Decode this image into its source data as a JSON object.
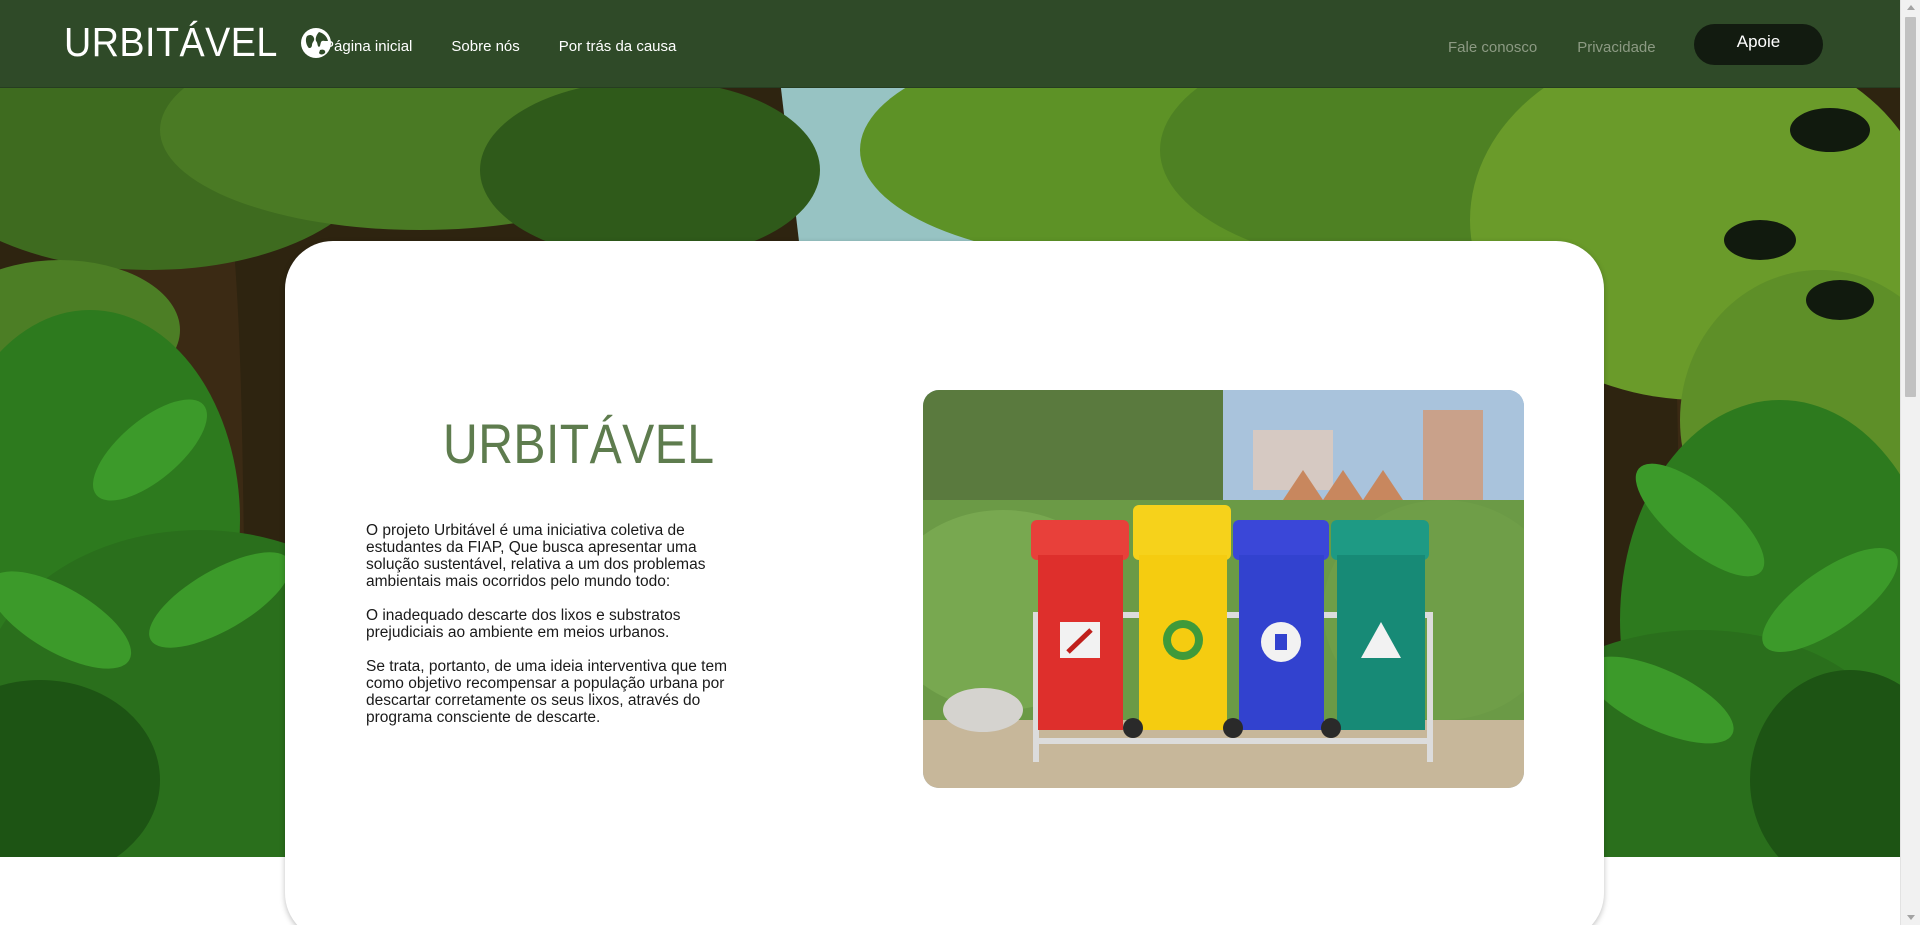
{
  "header": {
    "brand": "URBITÁVEL",
    "nav": [
      "Página inicial",
      "Sobre nós",
      "Por trás da causa"
    ],
    "nav_right": [
      "Fale conosco",
      "Privacidade"
    ],
    "support_label": "Apoie"
  },
  "hero": {
    "title": "URBITÁVEL",
    "paragraphs": [
      "O projeto Urbitável é uma iniciativa coletiva de estudantes da FIAP, Que busca apresentar uma solução sustentável, relativa a um dos problemas ambientais mais ocorridos pelo mundo todo:",
      "O inadequado descarte dos lixos e substratos prejudiciais ao ambiente em meios urbanos.",
      "Se trata, portanto, de uma ideia interventiva que tem como objetivo recompensar a população urbana por descartar corretamente os seus lixos, através do programa consciente de descarte."
    ]
  },
  "colors": {
    "header_bg": "#2f4a28",
    "button_bg": "#121b10",
    "title_green": "#5e7c4e"
  },
  "icons": [
    "globe-icon",
    "fire-extinguisher-icon",
    "recycle-icon",
    "trash-person-icon",
    "hazard-icon"
  ]
}
